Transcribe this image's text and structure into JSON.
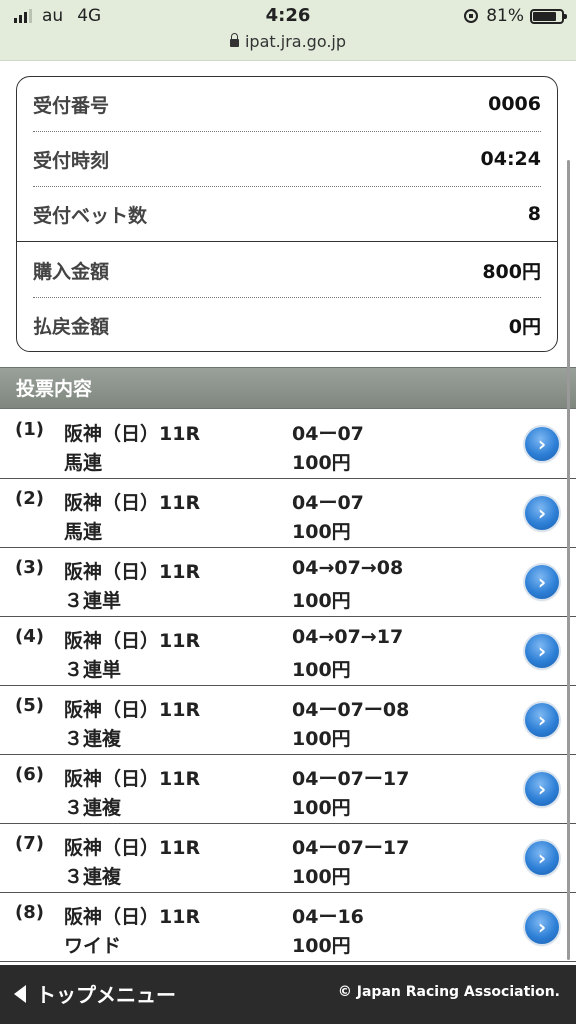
{
  "status_bar": {
    "carrier": "au",
    "network": "4G",
    "time": "4:26",
    "battery": "81%",
    "battery_level": 0.81,
    "url": "ipat.jra.go.jp"
  },
  "summary": {
    "rows": [
      {
        "label": "受付番号",
        "value": "0006"
      },
      {
        "label": "受付時刻",
        "value": "04:24"
      },
      {
        "label": "受付ベット数",
        "value": "8"
      },
      {
        "label": "購入金額",
        "value": "800円"
      },
      {
        "label": "払戻金額",
        "value": "0円"
      }
    ]
  },
  "section_title": "投票内容",
  "bets": [
    {
      "num": "(1)",
      "race": "阪神（日）11R",
      "type": "馬連",
      "combo": "04ー07",
      "amount": "100円"
    },
    {
      "num": "(2)",
      "race": "阪神（日）11R",
      "type": "馬連",
      "combo": "04ー07",
      "amount": "100円"
    },
    {
      "num": "(3)",
      "race": "阪神（日）11R",
      "type": "３連単",
      "combo": "04→07→08",
      "amount": "100円"
    },
    {
      "num": "(4)",
      "race": "阪神（日）11R",
      "type": "３連単",
      "combo": "04→07→17",
      "amount": "100円"
    },
    {
      "num": "(5)",
      "race": "阪神（日）11R",
      "type": "３連複",
      "combo": "04ー07ー08",
      "amount": "100円"
    },
    {
      "num": "(6)",
      "race": "阪神（日）11R",
      "type": "３連複",
      "combo": "04ー07ー17",
      "amount": "100円"
    },
    {
      "num": "(7)",
      "race": "阪神（日）11R",
      "type": "３連複",
      "combo": "04ー07ー17",
      "amount": "100円"
    },
    {
      "num": "(8)",
      "race": "阪神（日）11R",
      "type": "ワイド",
      "combo": "04ー16",
      "amount": "100円"
    }
  ],
  "footer": {
    "back_label": "トップメニュー",
    "copyright": "© Japan Racing Association."
  }
}
